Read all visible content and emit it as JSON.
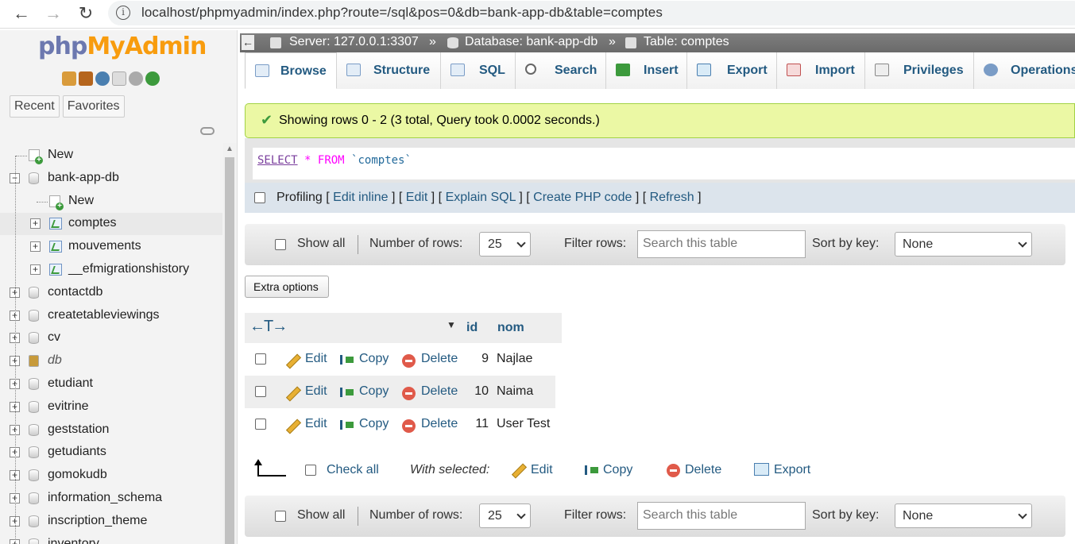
{
  "browser": {
    "url": "localhost/phpmyadmin/index.php?route=/sql&pos=0&db=bank-app-db&table=comptes"
  },
  "sidebar": {
    "logo_php": "php",
    "logo_myadmin": "MyAdmin",
    "tabs": [
      "Recent",
      "Favorites"
    ],
    "tree": [
      {
        "label": "New",
        "level": 0,
        "kind": "new"
      },
      {
        "label": "bank-app-db",
        "level": 0,
        "kind": "db",
        "expanded": true
      },
      {
        "label": "New",
        "level": 1,
        "kind": "new"
      },
      {
        "label": "comptes",
        "level": 1,
        "kind": "table",
        "selected": true
      },
      {
        "label": "mouvements",
        "level": 1,
        "kind": "table"
      },
      {
        "label": "__efmigrationshistory",
        "level": 1,
        "kind": "table"
      },
      {
        "label": "contactdb",
        "level": 0,
        "kind": "db"
      },
      {
        "label": "createtableviewings",
        "level": 0,
        "kind": "db"
      },
      {
        "label": "cv",
        "level": 0,
        "kind": "db"
      },
      {
        "label": "db",
        "level": 0,
        "kind": "db-special"
      },
      {
        "label": "etudiant",
        "level": 0,
        "kind": "db"
      },
      {
        "label": "evitrine",
        "level": 0,
        "kind": "db"
      },
      {
        "label": "geststation",
        "level": 0,
        "kind": "db"
      },
      {
        "label": "getudiants",
        "level": 0,
        "kind": "db"
      },
      {
        "label": "gomokudb",
        "level": 0,
        "kind": "db"
      },
      {
        "label": "information_schema",
        "level": 0,
        "kind": "db"
      },
      {
        "label": "inscription_theme",
        "level": 0,
        "kind": "db"
      },
      {
        "label": "inventory",
        "level": 0,
        "kind": "db"
      }
    ]
  },
  "breadcrumb": {
    "server": "Server: 127.0.0.1:3307",
    "database": "Database: bank-app-db",
    "table": "Table: comptes",
    "sep": "»"
  },
  "tabs": {
    "browse": "Browse",
    "structure": "Structure",
    "sql": "SQL",
    "search": "Search",
    "insert": "Insert",
    "export": "Export",
    "import": "Import",
    "privileges": "Privileges",
    "operations": "Operations"
  },
  "message": {
    "success": "Showing rows 0 - 2 (3 total, Query took 0.0002 seconds.)"
  },
  "sql": {
    "keyword": "SELECT",
    "star": "*",
    "from": "FROM",
    "identifier": "`comptes`"
  },
  "profiling": {
    "label": "Profiling",
    "links": [
      "Edit inline",
      "Edit",
      "Explain SQL",
      "Create PHP code",
      "Refresh"
    ]
  },
  "navbar": {
    "show_all": "Show all",
    "num_rows_label": "Number of rows:",
    "num_rows_value": "25",
    "filter_label": "Filter rows:",
    "filter_placeholder": "Search this table",
    "sort_label": "Sort by key:",
    "sort_value": "None"
  },
  "extra_options": "Extra options",
  "table": {
    "columns": [
      "id",
      "nom"
    ],
    "action_labels": {
      "edit": "Edit",
      "copy": "Copy",
      "delete": "Delete"
    },
    "rows": [
      {
        "id": "9",
        "nom": "Najlae"
      },
      {
        "id": "10",
        "nom": "Naima"
      },
      {
        "id": "11",
        "nom": "User Test"
      }
    ]
  },
  "bulk": {
    "check_all": "Check all",
    "with_selected": "With selected:",
    "edit": "Edit",
    "copy": "Copy",
    "delete": "Delete",
    "export": "Export"
  }
}
